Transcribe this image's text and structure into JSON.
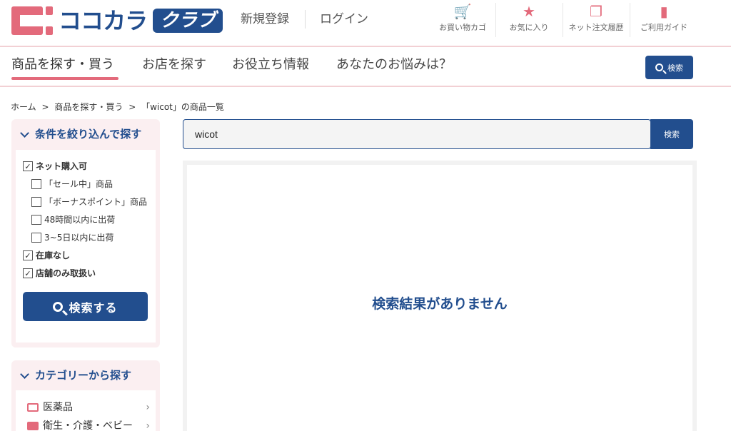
{
  "header": {
    "logo_text": "ココカラ",
    "logo_badge": "クラブ",
    "register_label": "新規登録",
    "login_label": "ログイン",
    "utilities": [
      {
        "label": "お買い物カゴ",
        "icon": "cart-icon"
      },
      {
        "label": "お気に入り",
        "icon": "star-icon"
      },
      {
        "label": "ネット注文履歴",
        "icon": "history-icon"
      },
      {
        "label": "ご利用ガイド",
        "icon": "guide-icon"
      }
    ]
  },
  "nav": {
    "items": [
      {
        "label": "商品を探す・買う",
        "active": true
      },
      {
        "label": "お店を探す"
      },
      {
        "label": "お役立ち情報"
      },
      {
        "label": "あなたのお悩みは？"
      }
    ],
    "search_label": "検索"
  },
  "breadcrumb": [
    "ホーム",
    ">",
    "商品を探す・買う",
    ">",
    "「wicot」の商品一覧"
  ],
  "filter": {
    "title": "条件を絞り込んで探す",
    "options": [
      {
        "label": "ネット購入可",
        "checked": true,
        "bold": true,
        "indent": false
      },
      {
        "label": "「セール中」商品",
        "checked": false,
        "bold": false,
        "indent": true
      },
      {
        "label": "「ボーナスポイント」商品",
        "checked": false,
        "bold": false,
        "indent": true
      },
      {
        "label": "48時間以内に出荷",
        "checked": false,
        "bold": false,
        "indent": true
      },
      {
        "label": "3~5日以内に出荷",
        "checked": false,
        "bold": false,
        "indent": true
      },
      {
        "label": "在庫なし",
        "checked": true,
        "bold": true,
        "indent": false
      },
      {
        "label": "店舗のみ取扱い",
        "checked": true,
        "bold": true,
        "indent": false
      }
    ],
    "search_button": "検索する"
  },
  "categories": {
    "title": "カテゴリーから探す",
    "items": [
      {
        "label": "医薬品",
        "icon": "medicine-icon"
      },
      {
        "label": "衛生・介護・ベビー",
        "icon": "baby-icon"
      }
    ]
  },
  "search": {
    "value": "wicot",
    "button_label": "検索"
  },
  "results": {
    "empty_message": "検索結果がありません"
  },
  "colors": {
    "brand_navy": "#224e8e",
    "brand_pink": "#e36a7b",
    "pink_bg": "#fbeff1"
  }
}
